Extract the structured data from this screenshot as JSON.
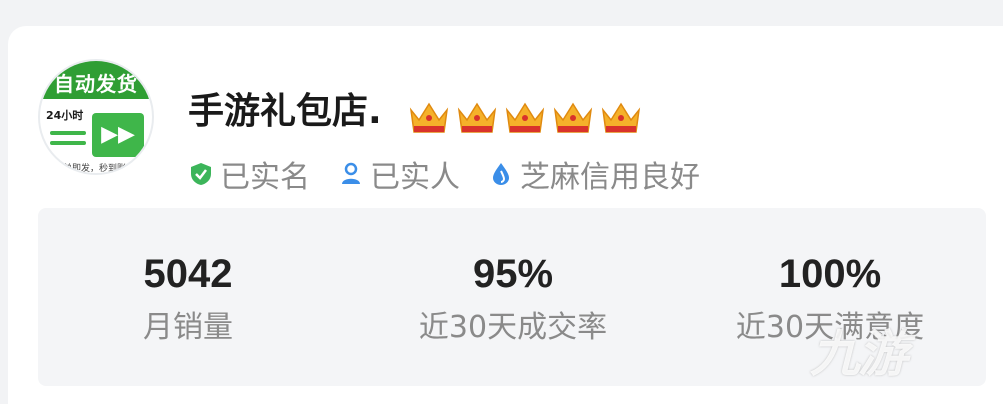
{
  "shop": {
    "name": "手游礼包店.",
    "crown_count": 5,
    "avatar": {
      "banner_text": "自动发货",
      "hours_text": "24小时",
      "note_text": "下单即发，秒到账"
    }
  },
  "verifications": [
    {
      "label": "已实名",
      "icon": "shield-check-icon"
    },
    {
      "label": "已实人",
      "icon": "person-icon"
    },
    {
      "label": "芝麻信用良好",
      "icon": "sesame-drop-icon"
    }
  ],
  "stats": [
    {
      "value": "5042",
      "label": "月销量"
    },
    {
      "value": "95%",
      "label": "近30天成交率"
    },
    {
      "value": "100%",
      "label": "近30天满意度"
    }
  ],
  "watermark": "九游",
  "colors": {
    "verify_green": "#3cb55a",
    "verify_blue": "#3b8ee8",
    "crown_gold": "#f5b12a",
    "crown_red": "#d9322b"
  }
}
